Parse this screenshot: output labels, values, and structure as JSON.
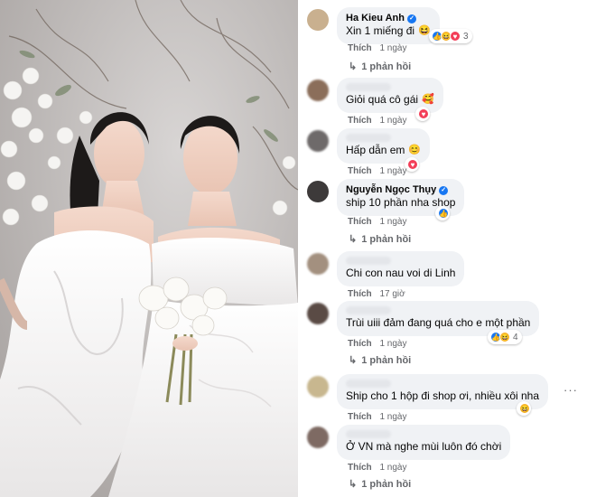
{
  "comments": [
    {
      "author": "Ha Kieu Anh",
      "verified": true,
      "text": "Xin 1 miếng đi",
      "emoji": "😆",
      "like": "Thích",
      "time": "1 ngày",
      "reactions": [
        "like",
        "haha",
        "heart"
      ],
      "reaction_count": "3",
      "replies": "1 phản hồi"
    },
    {
      "author": "",
      "verified": false,
      "text": "Giỏi quá cô gái",
      "emoji": "🥰",
      "like": "Thích",
      "time": "1 ngày",
      "reactions": [
        "heart"
      ],
      "reaction_count": "",
      "replies": ""
    },
    {
      "author": "",
      "verified": false,
      "text": "Hấp dẫn em",
      "emoji": "😊",
      "like": "Thích",
      "time": "1 ngày",
      "reactions": [
        "heart"
      ],
      "reaction_count": "",
      "replies": ""
    },
    {
      "author": "Nguyễn Ngọc Thụy",
      "verified": true,
      "text": "ship 10 phần nha shop",
      "emoji": "",
      "like": "Thích",
      "time": "1 ngày",
      "reactions": [
        "like"
      ],
      "reaction_count": "",
      "replies": "1 phản hồi"
    },
    {
      "author": "",
      "verified": false,
      "text": "Chi con nau voi di Linh",
      "emoji": "",
      "like": "Thích",
      "time": "17 giờ",
      "reactions": [],
      "reaction_count": "",
      "replies": ""
    },
    {
      "author": "",
      "verified": false,
      "text": "Trùi uiii đảm đang quá cho e một phần",
      "emoji": "",
      "like": "Thích",
      "time": "1 ngày",
      "reactions": [
        "like",
        "haha"
      ],
      "reaction_count": "4",
      "replies": "1 phản hồi"
    },
    {
      "author": "",
      "verified": false,
      "text": "Ship cho 1 hộp đi shop ơi, nhiều xôi nha",
      "emoji": "",
      "like": "Thích",
      "time": "1 ngày",
      "reactions": [
        "haha"
      ],
      "reaction_count": "",
      "replies": ""
    },
    {
      "author": "",
      "verified": false,
      "text": "Ở VN mà nghe mùi luôn đó chời",
      "emoji": "",
      "like": "Thích",
      "time": "1 ngày",
      "reactions": [],
      "reaction_count": "",
      "replies": "1 phản hồi"
    }
  ],
  "more_label": "···",
  "colors": {
    "accent": "#1877f2",
    "bubble": "#f0f2f5",
    "meta": "#65676b"
  }
}
